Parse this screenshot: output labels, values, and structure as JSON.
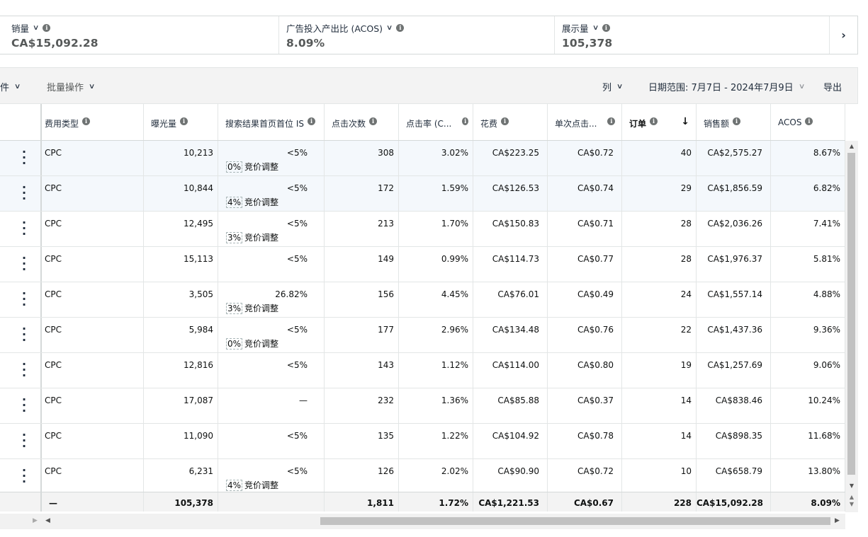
{
  "metrics": [
    {
      "label": "销量",
      "value": "CA$15,092.28"
    },
    {
      "label": "广告投入产出比 (ACOS)",
      "value": "8.09%"
    },
    {
      "label": "展示量",
      "value": "105,378"
    }
  ],
  "metrics_next": "›",
  "toolbar": {
    "filter_partial": "件",
    "bulk_actions": "批量操作",
    "columns": "列",
    "date_range": "日期范围: 7月7日 - 2024年7月9日",
    "export": "导出"
  },
  "table": {
    "headers": {
      "cost_type": "费用类型",
      "impressions": "曝光量",
      "top_of_search_is": "搜索结果首页首位 IS",
      "clicks": "点击次数",
      "ctr": "点击率 (C...",
      "spend": "花费",
      "cpc": "单次点击...",
      "orders": "订单",
      "sales": "销售额",
      "acos": "ACOS"
    },
    "sort_icon": "↓",
    "bid_adjust_label": "竞价调整",
    "rows": [
      {
        "cost_type": "CPC",
        "impressions": "10,213",
        "top_is": "<5%",
        "bid_adj": "0%",
        "clicks": "308",
        "ctr": "3.02%",
        "spend": "CA$223.25",
        "cpc": "CA$0.72",
        "orders": "40",
        "sales": "CA$2,575.27",
        "acos": "8.67%"
      },
      {
        "cost_type": "CPC",
        "impressions": "10,844",
        "top_is": "<5%",
        "bid_adj": "4%",
        "clicks": "172",
        "ctr": "1.59%",
        "spend": "CA$126.53",
        "cpc": "CA$0.74",
        "orders": "29",
        "sales": "CA$1,856.59",
        "acos": "6.82%"
      },
      {
        "cost_type": "CPC",
        "impressions": "12,495",
        "top_is": "<5%",
        "bid_adj": "3%",
        "clicks": "213",
        "ctr": "1.70%",
        "spend": "CA$150.83",
        "cpc": "CA$0.71",
        "orders": "28",
        "sales": "CA$2,036.26",
        "acos": "7.41%"
      },
      {
        "cost_type": "CPC",
        "impressions": "15,113",
        "top_is": "<5%",
        "bid_adj": "",
        "clicks": "149",
        "ctr": "0.99%",
        "spend": "CA$114.73",
        "cpc": "CA$0.77",
        "orders": "28",
        "sales": "CA$1,976.37",
        "acos": "5.81%"
      },
      {
        "cost_type": "CPC",
        "impressions": "3,505",
        "top_is": "26.82%",
        "bid_adj": "3%",
        "clicks": "156",
        "ctr": "4.45%",
        "spend": "CA$76.01",
        "cpc": "CA$0.49",
        "orders": "24",
        "sales": "CA$1,557.14",
        "acos": "4.88%"
      },
      {
        "cost_type": "CPC",
        "impressions": "5,984",
        "top_is": "<5%",
        "bid_adj": "0%",
        "clicks": "177",
        "ctr": "2.96%",
        "spend": "CA$134.48",
        "cpc": "CA$0.76",
        "orders": "22",
        "sales": "CA$1,437.36",
        "acos": "9.36%"
      },
      {
        "cost_type": "CPC",
        "impressions": "12,816",
        "top_is": "<5%",
        "bid_adj": "",
        "clicks": "143",
        "ctr": "1.12%",
        "spend": "CA$114.00",
        "cpc": "CA$0.80",
        "orders": "19",
        "sales": "CA$1,257.69",
        "acos": "9.06%"
      },
      {
        "cost_type": "CPC",
        "impressions": "17,087",
        "top_is": "—",
        "bid_adj": "",
        "clicks": "232",
        "ctr": "1.36%",
        "spend": "CA$85.88",
        "cpc": "CA$0.37",
        "orders": "14",
        "sales": "CA$838.46",
        "acos": "10.24%"
      },
      {
        "cost_type": "CPC",
        "impressions": "11,090",
        "top_is": "<5%",
        "bid_adj": "",
        "clicks": "135",
        "ctr": "1.22%",
        "spend": "CA$104.92",
        "cpc": "CA$0.78",
        "orders": "14",
        "sales": "CA$898.35",
        "acos": "11.68%"
      },
      {
        "cost_type": "CPC",
        "impressions": "6,231",
        "top_is": "<5%",
        "bid_adj": "4%",
        "clicks": "126",
        "ctr": "2.02%",
        "spend": "CA$90.90",
        "cpc": "CA$0.72",
        "orders": "10",
        "sales": "CA$658.79",
        "acos": "13.80%"
      }
    ],
    "totals": {
      "cost_type": "—",
      "impressions": "105,378",
      "clicks": "1,811",
      "ctr": "1.72%",
      "spend": "CA$1,221.53",
      "cpc": "CA$0.67",
      "orders": "228",
      "sales": "CA$15,092.28",
      "acos": "8.09%"
    }
  }
}
